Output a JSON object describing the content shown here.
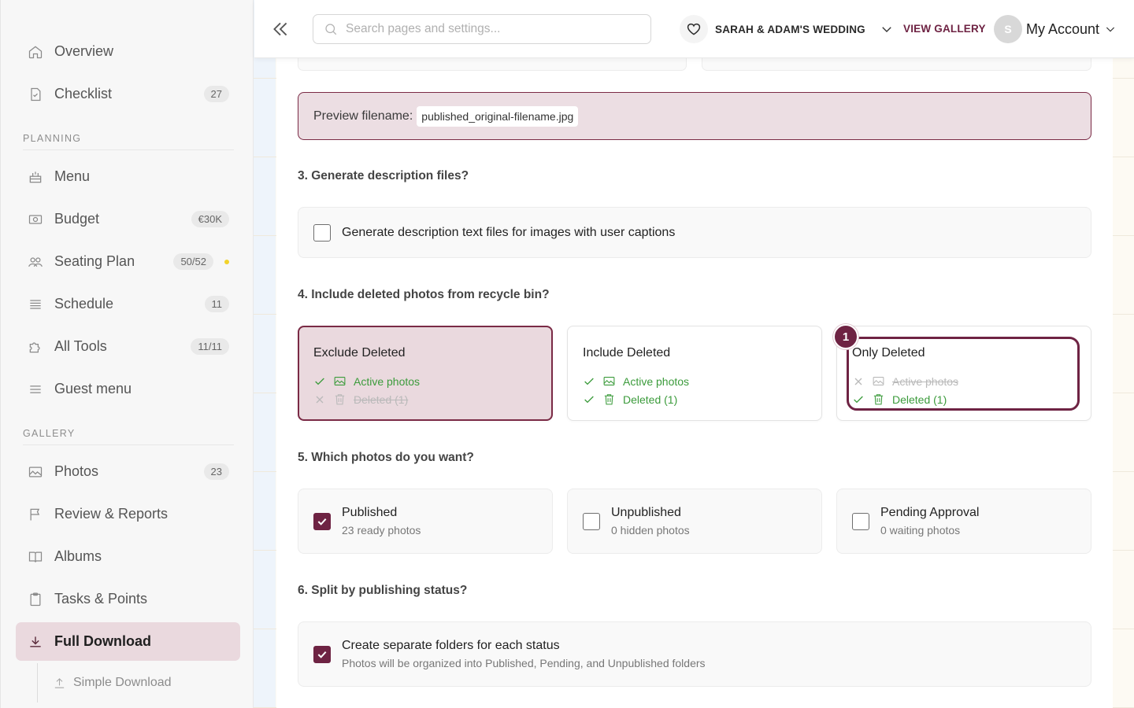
{
  "sidebar": {
    "items": [
      {
        "label": "Overview",
        "icon": "home-icon"
      },
      {
        "label": "Checklist",
        "badge": "27",
        "icon": "checklist-icon"
      },
      {
        "label": "Menu",
        "icon": "cake-icon"
      },
      {
        "label": "Budget",
        "badge": "€30K",
        "icon": "money-icon"
      },
      {
        "label": "Seating Plan",
        "badge": "50/52",
        "icon": "people-icon"
      },
      {
        "label": "Schedule",
        "badge": "11",
        "icon": "list-icon"
      },
      {
        "label": "All Tools",
        "badge": "11/11",
        "icon": "puzzle-icon"
      },
      {
        "label": "Guest menu",
        "icon": "menu-icon"
      },
      {
        "label": "Photos",
        "badge": "23",
        "icon": "image-icon"
      },
      {
        "label": "Review & Reports",
        "icon": "flag-icon"
      },
      {
        "label": "Albums",
        "icon": "book-icon"
      },
      {
        "label": "Tasks & Points",
        "icon": "clipboard-icon"
      },
      {
        "label": "Full Download",
        "icon": "download-icon",
        "active": true
      }
    ],
    "sections": {
      "planning": "PLANNING",
      "gallery": "GALLERY"
    },
    "sub_item": "Simple Download",
    "status_dot_color": "#f2d32b"
  },
  "header": {
    "search_placeholder": "Search pages and settings...",
    "event_name": "SARAH & ADAM'S WEDDING",
    "view_gallery": "VIEW GALLERY",
    "avatar_initial": "S",
    "account_label": "My Account"
  },
  "main": {
    "preview_label": "Preview filename:",
    "preview_value": "published_original-filename.jpg",
    "q3": {
      "title": "3. Generate description files?",
      "option": "Generate description text files for images with user captions",
      "checked": false
    },
    "q4": {
      "title": "4. Include deleted photos from recycle bin?",
      "cards": [
        {
          "title": "Exclude Deleted",
          "active": "Active photos",
          "deleted": "Deleted (1)",
          "selected": true
        },
        {
          "title": "Include Deleted",
          "active": "Active photos",
          "deleted": "Deleted (1)",
          "selected": false
        },
        {
          "title": "Only Deleted",
          "active": "Active photos",
          "deleted": "Deleted (1)",
          "selected": false
        }
      ],
      "marker": "1"
    },
    "q5": {
      "title": "5. Which photos do you want?",
      "cards": [
        {
          "title": "Published",
          "sub": "23 ready photos",
          "checked": true
        },
        {
          "title": "Unpublished",
          "sub": "0 hidden photos",
          "checked": false
        },
        {
          "title": "Pending Approval",
          "sub": "0 waiting photos",
          "checked": false
        }
      ]
    },
    "q6": {
      "title": "6. Split by publishing status?",
      "option": "Create separate folders for each status",
      "sub": "Photos will be organized into Published, Pending, and Unpublished folders",
      "checked": true
    }
  },
  "colors": {
    "accent": "#6e2343",
    "accent_bg": "#ead9de",
    "success": "#3b9b3b"
  }
}
